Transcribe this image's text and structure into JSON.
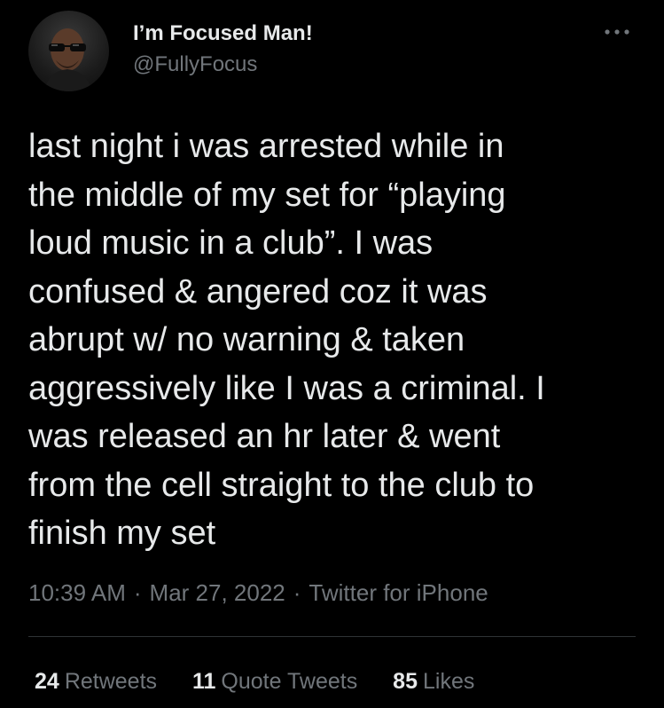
{
  "author": {
    "display_name": "I’m Focused Man!",
    "handle": "@FullyFocus",
    "avatar": "profile-photo-man-with-sunglasses"
  },
  "more_menu": {
    "icon": "more-horizontal-icon"
  },
  "tweet": {
    "text": "last night i was arrested while in\nthe middle of my set for “playing\nloud music in a club”. I was\nconfused & angered coz it was\nabrupt w/ no warning & taken\naggressively like I was a criminal. I\nwas released an hr later & went\nfrom the cell straight to the club to\nfinish my set"
  },
  "meta": {
    "time": "10:39 AM",
    "separator": "·",
    "date": "Mar 27, 2022",
    "source": "Twitter for iPhone"
  },
  "stats": {
    "retweets": {
      "count": "24",
      "label": "Retweets"
    },
    "quote_tweets": {
      "count": "11",
      "label": "Quote Tweets"
    },
    "likes": {
      "count": "85",
      "label": "Likes"
    }
  },
  "colors": {
    "background": "#000000",
    "primary_text": "#e7e9ea",
    "secondary_text": "#71767b",
    "divider": "#2f3336"
  }
}
